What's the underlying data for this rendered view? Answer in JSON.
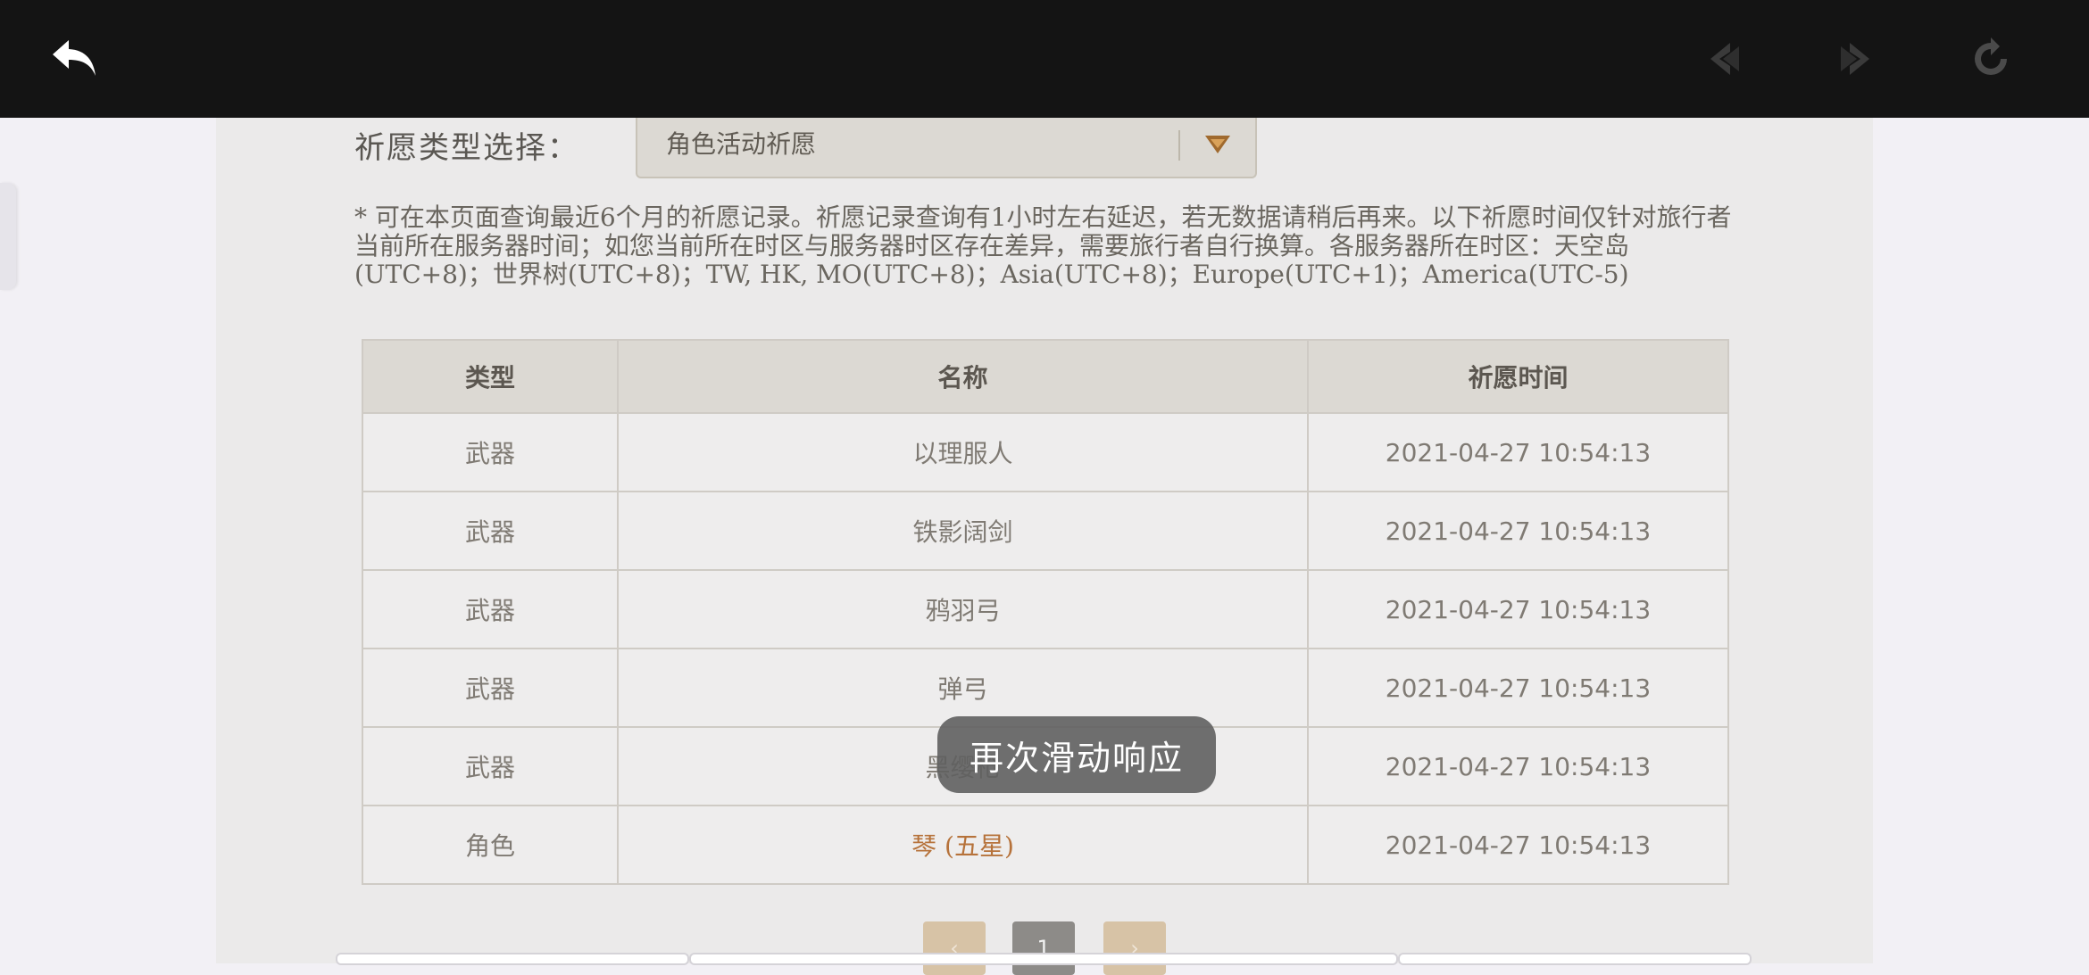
{
  "topbar": {
    "back_icon": "back-arrow-icon",
    "prev_icon": "nav-back-icon",
    "next_icon": "nav-forward-icon",
    "refresh_icon": "refresh-icon"
  },
  "filter": {
    "label": "祈愿类型选择：",
    "selected": "角色活动祈愿"
  },
  "notice": "* 可在本页面查询最近6个月的祈愿记录。祈愿记录查询有1小时左右延迟，若无数据请稍后再来。以下祈愿时间仅针对旅行者当前所在服务器时间；如您当前所在时区与服务器时区存在差异，需要旅行者自行换算。各服务器所在时区：天空岛(UTC+8)；世界树(UTC+8)；TW, HK, MO(UTC+8)；Asia(UTC+8)；Europe(UTC+1)；America(UTC-5)",
  "table": {
    "headers": [
      "类型",
      "名称",
      "祈愿时间"
    ],
    "rows": [
      {
        "type": "武器",
        "name": "以理服人",
        "time": "2021-04-27 10:54:13"
      },
      {
        "type": "武器",
        "name": "铁影阔剑",
        "time": "2021-04-27 10:54:13"
      },
      {
        "type": "武器",
        "name": "鸦羽弓",
        "time": "2021-04-27 10:54:13"
      },
      {
        "type": "武器",
        "name": "弹弓",
        "time": "2021-04-27 10:54:13"
      },
      {
        "type": "武器",
        "name": "黑缨枪",
        "time": "2021-04-27 10:54:13"
      },
      {
        "type": "角色",
        "name": "琴 (五星)",
        "time": "2021-04-27 10:54:13"
      }
    ]
  },
  "toast": "再次滑动响应",
  "pager": {
    "prev": "‹",
    "page": "1",
    "next": "›"
  },
  "colors": {
    "topbar": "#141414",
    "panel": "#ebeaea",
    "five_star": "#b6723a",
    "pager_accent": "#d7c3a6"
  }
}
